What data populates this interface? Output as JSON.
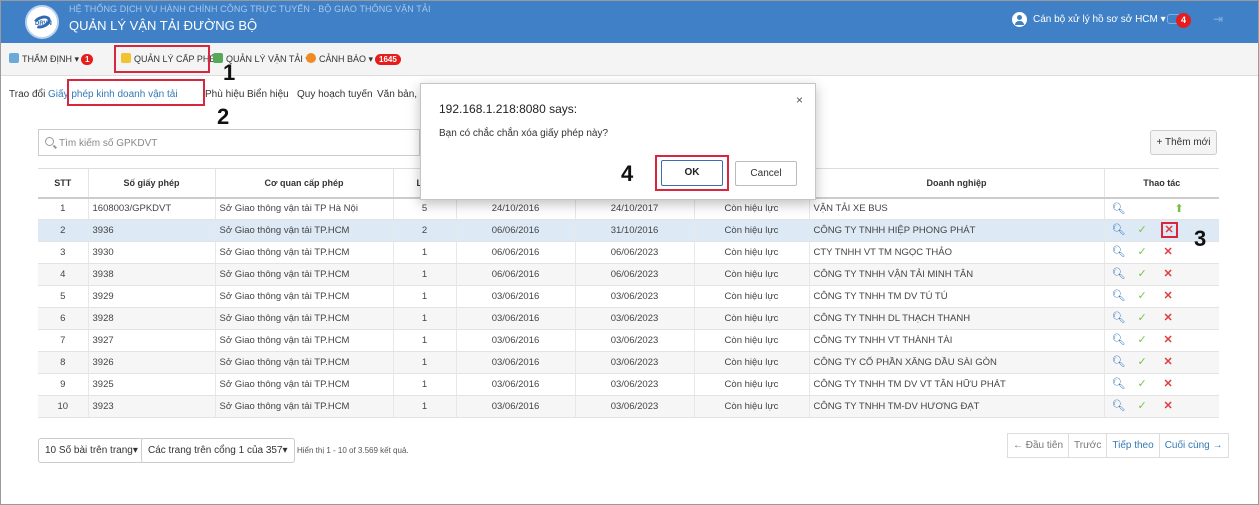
{
  "header": {
    "subtitle": "HỆ THỐNG DỊCH VỤ HÀNH CHÍNH CÔNG TRỰC TUYẾN - BỘ GIAO THÔNG VẬN TẢI",
    "title": "QUẢN LÝ VẬN TẢI ĐƯỜNG BỘ",
    "user": "Cán bộ xử lý hồ sơ sở HCM ▾",
    "notification_count": "4"
  },
  "menu": {
    "thamdinh": "THẨM ĐỊNH ▾",
    "thamdinh_badge": "1",
    "qlcp": "QUẢN LÝ CẤP PHÉP",
    "qlvt": "QUẢN LÝ VẬN TẢI ▾",
    "canhbao": "CẢNH BÁO ▾",
    "canhbao_badge": "1645"
  },
  "subtabs": {
    "t1": "Trao đổi",
    "t2": "Giấy phép kinh doanh vận tải",
    "t3": "Phù hiệu",
    "t4": "Biển hiệu",
    "t5": "Quy hoạch tuyến",
    "t6": "Văn bản, ("
  },
  "search": {
    "placeholder": "Tìm kiếm số GPKDVT"
  },
  "add_button": "+ Thêm mới",
  "table": {
    "headers": {
      "stt": "STT",
      "so": "Số giấy phép",
      "coquan": "Cơ quan cấp phép",
      "lan": "Lần",
      "dn": "Doanh nghiệp",
      "thaotac": "Thao tác"
    },
    "rows": [
      {
        "stt": "1",
        "so": "1608003/GPKDVT",
        "coquan": "Sở Giao thông vận tải TP Hà Nội",
        "lan": "5",
        "ngaycap": "24/10/2016",
        "hethan": "24/10/2017",
        "trangthai": "Còn hiệu lực",
        "dn": "VẬN TẢI XE BUS"
      },
      {
        "stt": "2",
        "so": "3936",
        "coquan": "Sở Giao thông vận tải TP.HCM",
        "lan": "2",
        "ngaycap": "06/06/2016",
        "hethan": "31/10/2016",
        "trangthai": "Còn hiệu lực",
        "dn": "CÔNG TY TNHH HIỆP PHONG PHÁT"
      },
      {
        "stt": "3",
        "so": "3930",
        "coquan": "Sở Giao thông vận tải TP.HCM",
        "lan": "1",
        "ngaycap": "06/06/2016",
        "hethan": "06/06/2023",
        "trangthai": "Còn hiệu lực",
        "dn": "CTY TNHH VT TM NGỌC THẢO"
      },
      {
        "stt": "4",
        "so": "3938",
        "coquan": "Sở Giao thông vận tải TP.HCM",
        "lan": "1",
        "ngaycap": "06/06/2016",
        "hethan": "06/06/2023",
        "trangthai": "Còn hiệu lực",
        "dn": "CÔNG TY TNHH VẬN TẢI MINH TÂN"
      },
      {
        "stt": "5",
        "so": "3929",
        "coquan": "Sở Giao thông vận tải TP.HCM",
        "lan": "1",
        "ngaycap": "03/06/2016",
        "hethan": "03/06/2023",
        "trangthai": "Còn hiệu lực",
        "dn": "CÔNG TY TNHH TM DV TÚ TÚ"
      },
      {
        "stt": "6",
        "so": "3928",
        "coquan": "Sở Giao thông vận tải TP.HCM",
        "lan": "1",
        "ngaycap": "03/06/2016",
        "hethan": "03/06/2023",
        "trangthai": "Còn hiệu lực",
        "dn": "CÔNG TY TNHH DL THẠCH THANH"
      },
      {
        "stt": "7",
        "so": "3927",
        "coquan": "Sở Giao thông vận tải TP.HCM",
        "lan": "1",
        "ngaycap": "03/06/2016",
        "hethan": "03/06/2023",
        "trangthai": "Còn hiệu lực",
        "dn": "CÔNG TY TNHH VT THÀNH TÀI"
      },
      {
        "stt": "8",
        "so": "3926",
        "coquan": "Sở Giao thông vận tải TP.HCM",
        "lan": "1",
        "ngaycap": "03/06/2016",
        "hethan": "03/06/2023",
        "trangthai": "Còn hiệu lực",
        "dn": "CÔNG TY CỔ PHẦN XĂNG DẦU SÀI GÒN"
      },
      {
        "stt": "9",
        "so": "3925",
        "coquan": "Sở Giao thông vận tải TP.HCM",
        "lan": "1",
        "ngaycap": "03/06/2016",
        "hethan": "03/06/2023",
        "trangthai": "Còn hiệu lực",
        "dn": "CÔNG TY TNHH TM DV VT TÂN HỮU PHÁT"
      },
      {
        "stt": "10",
        "so": "3923",
        "coquan": "Sở Giao thông vận tải TP.HCM",
        "lan": "1",
        "ngaycap": "03/06/2016",
        "hethan": "03/06/2023",
        "trangthai": "Còn hiệu lực",
        "dn": "CÔNG TY TNHH TM-DV HƯƠNG ĐẠT"
      }
    ]
  },
  "footer": {
    "per_page": "10 Số bài trên trang▾",
    "page_select": "Các trang trên cổng 1 của 357▾",
    "info": "Hiển thị 1 - 10 of 3.569 kết quả.",
    "first": "← Đầu tiên",
    "prev": "Trước",
    "next": "Tiếp theo",
    "last": "Cuối cùng →"
  },
  "dialog": {
    "title": "192.168.1.218:8080 says:",
    "message": "Bạn có chắc chắn xóa giấy phép này?",
    "ok": "OK",
    "cancel": "Cancel",
    "close": "×"
  },
  "annotations": {
    "a1": "1",
    "a2": "2",
    "a3": "3",
    "a4": "4"
  },
  "icons": {
    "logo": "ministry-logo-icon",
    "user": "user-icon",
    "chat": "chat-icon",
    "logout": "logout-icon",
    "search": "search-icon",
    "view": "view-document-icon",
    "edit": "edit-icon",
    "delete": "delete-icon",
    "upload": "upload-icon"
  },
  "colors": {
    "header_bg": "#3f80c6",
    "badge": "#e51d1d",
    "link": "#337ab7",
    "highlight_box": "#d7263d"
  }
}
